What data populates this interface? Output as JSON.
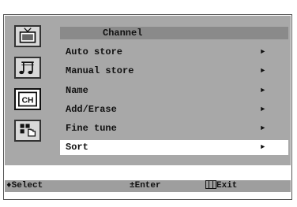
{
  "menu": {
    "title": "Channel",
    "items": [
      {
        "label": "Auto store",
        "arrow": "►"
      },
      {
        "label": "Manual store",
        "arrow": "►"
      },
      {
        "label": "Name",
        "arrow": "►"
      },
      {
        "label": "Add/Erase",
        "arrow": "►"
      },
      {
        "label": "Fine tune",
        "arrow": "►"
      },
      {
        "label": "Sort",
        "arrow": "►"
      }
    ],
    "selected_index": 5
  },
  "sidebar": {
    "icons": [
      "tv-picture-icon",
      "music-note-icon",
      "channel-ch-icon",
      "setup-hand-icon"
    ],
    "ch_label": "CH"
  },
  "status": {
    "select": "Select",
    "select_symbol": "♦",
    "enter": "Enter",
    "enter_symbol": "±",
    "exit": "Exit"
  }
}
